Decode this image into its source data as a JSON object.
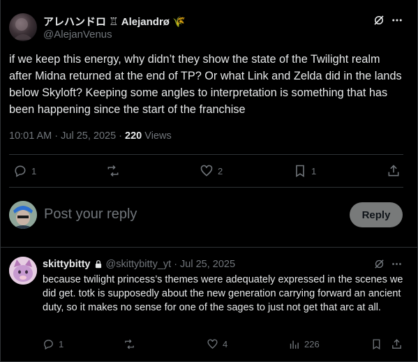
{
  "post": {
    "author": {
      "display_name": "アレハンドロ ♖ Alejandrø 🌾",
      "handle": "@AlejanVenus"
    },
    "text": "if we keep this energy, why didn’t they show the state of the Twilight realm after Midna returned at the end of TP? Or what Link and Zelda did in the lands below Skyloft? Keeping some angles to interpretation is something that has been happening since the start of the franchise",
    "timestamp": "10:01 AM · Jul 25, 2025 · ",
    "views_count": "220",
    "views_label": " Views",
    "actions": {
      "replies": "1",
      "reposts": "",
      "likes": "2",
      "bookmarks": "1"
    }
  },
  "composer": {
    "placeholder": "Post your reply",
    "button_label": "Reply"
  },
  "reply": {
    "display_name": "skittybitty",
    "handle": "@skittybitty_yt",
    "separator": "·",
    "date": "Jul 25, 2025",
    "text": "because twilight princess’s themes were adequately expressed in the scenes we did get. totk is supposedly about the new generation carrying forward an ancient duty, so it makes no sense for one of the sages to just not get that arc at all.",
    "actions": {
      "replies": "1",
      "reposts": "",
      "likes": "4",
      "views": "226"
    }
  },
  "colors": {
    "background": "#000000",
    "text_primary": "#e7e9ea",
    "text_secondary": "#71767b",
    "divider": "#2f3336",
    "reply_button": "#787a7a"
  }
}
